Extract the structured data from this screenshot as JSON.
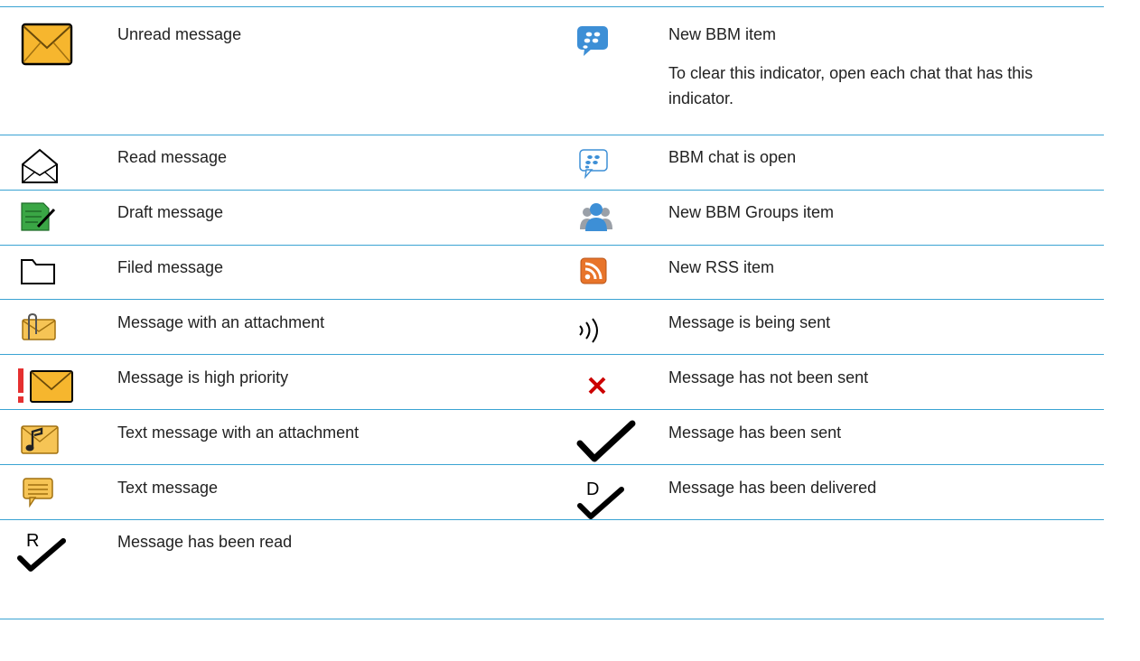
{
  "rows": [
    {
      "left": {
        "icon": "unread-envelope-icon",
        "label": "Unread message"
      },
      "right": {
        "icon": "bbm-new-item-icon",
        "label": "New BBM item",
        "note": "To clear this indicator, open each chat that has this indicator."
      }
    },
    {
      "left": {
        "icon": "read-envelope-icon",
        "label": "Read message"
      },
      "right": {
        "icon": "bbm-chat-open-icon",
        "label": "BBM chat is open"
      }
    },
    {
      "left": {
        "icon": "draft-message-icon",
        "label": "Draft message"
      },
      "right": {
        "icon": "bbm-groups-icon",
        "label": "New BBM Groups item"
      }
    },
    {
      "left": {
        "icon": "folder-icon",
        "label": "Filed message"
      },
      "right": {
        "icon": "rss-icon",
        "label": "New RSS item"
      }
    },
    {
      "left": {
        "icon": "attachment-envelope-icon",
        "label": "Message with an attachment"
      },
      "right": {
        "icon": "sending-waves-icon",
        "label": "Message is being sent"
      }
    },
    {
      "left": {
        "icon": "high-priority-envelope-icon",
        "label": "Message is high priority"
      },
      "right": {
        "icon": "not-sent-x-icon",
        "label": "Message has not been sent"
      }
    },
    {
      "left": {
        "icon": "text-attachment-envelope-icon",
        "label": "Text message with an attachment"
      },
      "right": {
        "icon": "sent-check-icon",
        "label": "Message has been sent"
      }
    },
    {
      "left": {
        "icon": "text-message-bubble-icon",
        "label": "Text message"
      },
      "right": {
        "icon": "delivered-check-icon",
        "label": "Message has been delivered",
        "icon_letter": "D"
      }
    },
    {
      "left": {
        "icon": "read-check-icon",
        "label": "Message has been read",
        "icon_letter": "R"
      }
    }
  ],
  "colors": {
    "rule": "#3aa3d3",
    "envelope": "#f6b62e",
    "bbm": "#3d8fd6",
    "draft": "#3aa645",
    "rss": "#e8742a",
    "error": "#cc0000"
  }
}
